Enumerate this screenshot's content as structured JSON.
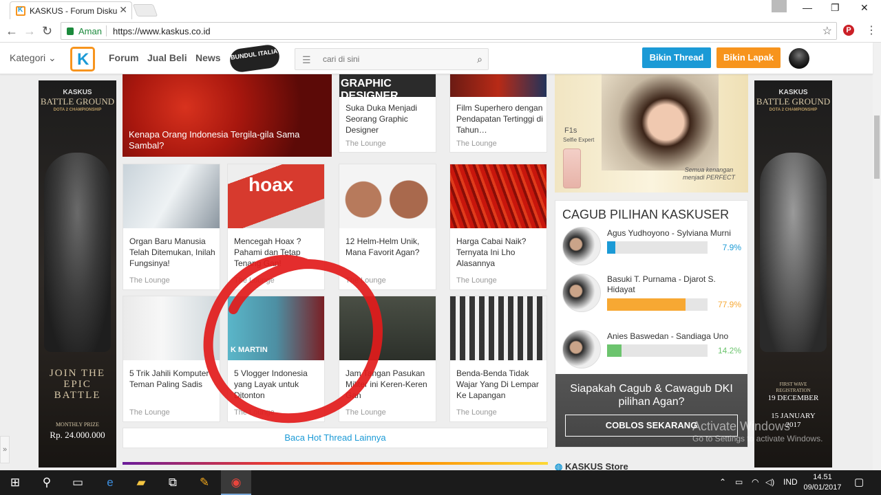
{
  "browser": {
    "tab_title": "KASKUS - Forum Diskusi",
    "secure_label": "Aman",
    "url": "https://www.kaskus.co.id"
  },
  "header": {
    "kategori": "Kategori",
    "nav": [
      "Forum",
      "Jual Beli",
      "News"
    ],
    "bundul": "BUNDUL ITALIA",
    "search_placeholder": "cari di sini",
    "btn_thread": "Bikin Thread",
    "btn_lapak": "Bikin Lapak"
  },
  "left_ad": {
    "brand": "KASKUS",
    "title": "BATTLE GROUND",
    "subtitle": "DOTA 2 CHAMPIONSHIP",
    "cta": "JOIN THE EPIC BATTLE",
    "prize_label": "MONTHLY PRIZE",
    "prize": "Rp. 24.000.000"
  },
  "right_ad": {
    "brand": "KASKUS",
    "title": "BATTLE GROUND",
    "subtitle": "DOTA 2 CHAMPIONSHIP",
    "reg_label": "FIRST WAVE REGISTRATION",
    "reg_start": "19 DECEMBER",
    "reg_end": "15 JANUARY 2017"
  },
  "threads": {
    "big": {
      "title": "Kenapa Orang Indonesia Tergila-gila Sama Sambal?"
    },
    "top": [
      {
        "title": "Suka Duka Menjadi Seorang Graphic Designer",
        "category": "The Lounge",
        "img_text": "GRAPHIC DESIGNER"
      },
      {
        "title": "Film Superhero dengan Pendapatan Tertinggi di Tahun…",
        "category": "The Lounge"
      }
    ],
    "row2": [
      {
        "title": "Organ Baru Manusia Telah Ditemukan, Inilah Fungsinya!",
        "category": "The Lounge"
      },
      {
        "title": "Mencegah Hoax ? Pahami dan Tetap Tenang Gan!",
        "category": "The Lounge",
        "img_text": "hoax"
      },
      {
        "title": "12 Helm-Helm Unik, Mana Favorit Agan?",
        "category": "The Lounge"
      },
      {
        "title": "Harga Cabai Naik? Ternyata Ini Lho Alasannya",
        "category": "The Lounge"
      }
    ],
    "row3": [
      {
        "title": "5 Trik Jahili Komputer Teman Paling Sadis",
        "category": "The Lounge"
      },
      {
        "title": "5 Vlogger Indonesia yang Layak untuk Ditonton",
        "category": "The Lounge",
        "img_text": "K MARTIN"
      },
      {
        "title": "Jam Tangan Pasukan Militer ini Keren-Keren Gan",
        "category": "The Lounge"
      },
      {
        "title": "Benda-Benda Tidak Wajar Yang Di Lempar Ke Lapangan",
        "category": "The Lounge"
      }
    ],
    "more": "Baca Hot Thread Lainnya"
  },
  "promo": {
    "model": "F1s",
    "tagline": "Selfie Expert",
    "slogan": "Semua kenangan menjadi PERFECT"
  },
  "poll": {
    "title": "CAGUB PILIHAN KASKUSER",
    "candidates": [
      {
        "name": "Agus Yudhoyono - Sylviana Murni",
        "pct": "7.9%",
        "value": 7.9,
        "color": "#1b9ad6"
      },
      {
        "name": "Basuki T. Purnama - Djarot S. Hidayat",
        "pct": "77.9%",
        "value": 77.9,
        "color": "#f7a833"
      },
      {
        "name": "Anies Baswedan - Sandiaga Uno",
        "pct": "14.2%",
        "value": 14.2,
        "color": "#6cc46e"
      }
    ],
    "question": "Siapakah Cagub & Cawagub DKI pilihan Agan?",
    "cta": "COBLOS SEKARANG"
  },
  "store_label": "KASKUS Store",
  "watermark": {
    "line1": "Activate Windows",
    "line2": "Go to Settings to activate Windows."
  },
  "taskbar": {
    "lang": "IND",
    "time": "14.51",
    "date": "09/01/2017"
  }
}
